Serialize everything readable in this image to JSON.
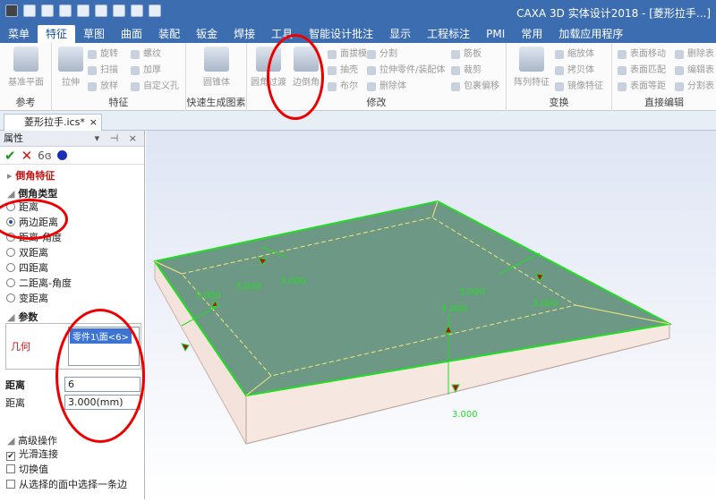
{
  "app": {
    "title": "CAXA 3D 实体设计2018 - [菱形拉手...]"
  },
  "tabs": [
    "菜单",
    "特征",
    "草图",
    "曲面",
    "装配",
    "钣金",
    "焊接",
    "工具",
    "智能设计批注",
    "显示",
    "工程标注",
    "PMI",
    "常用",
    "加载应用程序"
  ],
  "ribbon": {
    "groups": {
      "ref": "参考",
      "feature": "特征",
      "quick": "快速生成图素",
      "modify": "修改",
      "transform": "变换",
      "direct": "直接编辑"
    },
    "buttons": {
      "base_plane": "基准平面",
      "extrude": "拉伸",
      "revolve": "旋转",
      "sweep": "扫描",
      "loft": "放样",
      "thread": "螺纹",
      "thicken": "加厚",
      "custom_hole": "自定义孔",
      "cone": "圆锥体",
      "fillet": "圆角过渡",
      "chamfer": "边倒角",
      "face_draft": "面拔模",
      "shell": "抽壳",
      "boolean": "布尔",
      "split": "分割",
      "extrude_to_part": "拉伸零件/装配体",
      "delete_body": "删除体",
      "rib": "筋板",
      "trim": "裁剪",
      "wrap_offset": "包裹偏移",
      "pattern": "阵列特征",
      "scale": "缩放体",
      "copy_body": "拷贝体",
      "mirror": "镜像特征",
      "face_move": "表面移动",
      "face_match": "表面匹配",
      "face_equidist": "表面等距",
      "delete_face": "删除表",
      "edit_face": "编辑表",
      "split_face": "分割表"
    }
  },
  "document_tab": {
    "label": "菱形拉手.ics*",
    "close": "×"
  },
  "panel": {
    "title": "属性",
    "header_controls": "▾ ⊣ ×",
    "feature_name": "倒角特征",
    "section_type": "倒角类型",
    "types": [
      "距离",
      "两边距离",
      "距离-角度",
      "双距离",
      "四距离",
      "二距离-角度",
      "变距离"
    ],
    "selected_type": "两边距离",
    "section_params": "参数",
    "geometry_label": "几何",
    "geometry_item": "零件1\\面<6>",
    "distance_label": "距离",
    "distance_value": "6",
    "distance2_label": "距离",
    "distance2_value": "3.000(mm)",
    "section_advanced": "高级操作",
    "options": [
      {
        "label": "光滑连接",
        "checked": true
      },
      {
        "label": "切换值",
        "checked": false
      },
      {
        "label": "从选择的面中选择一条边",
        "checked": false
      }
    ]
  },
  "viewport": {
    "dims": [
      "3.000",
      "3.000",
      "3.000",
      "3.000",
      "3.000",
      "3.000",
      "3.000"
    ]
  },
  "colors": {
    "accent": "#3c6db0",
    "highlight": "#e00000",
    "edge": "#22dd22"
  }
}
